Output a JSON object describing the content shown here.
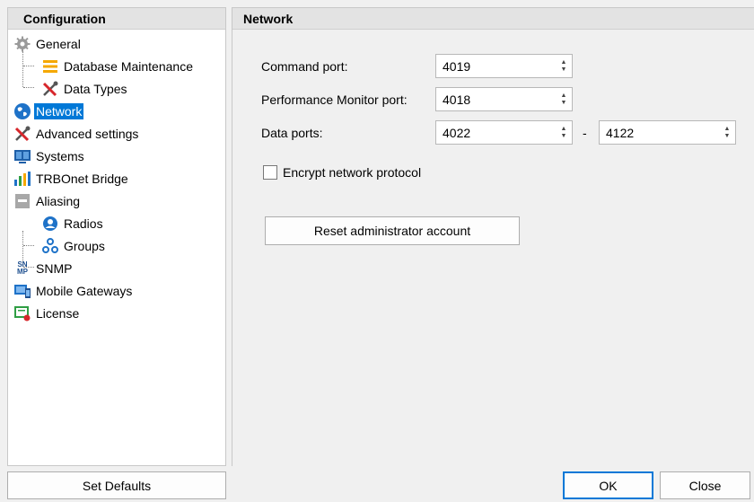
{
  "left": {
    "header": "Configuration",
    "items": [
      {
        "label": "General",
        "icon": "gear-icon"
      },
      {
        "label": "Database Maintenance",
        "icon": "database-maintenance-icon"
      },
      {
        "label": "Data Types",
        "icon": "tools-icon"
      },
      {
        "label": "Network",
        "icon": "globe-icon"
      },
      {
        "label": "Advanced settings",
        "icon": "tools-icon"
      },
      {
        "label": "Systems",
        "icon": "systems-icon"
      },
      {
        "label": "TRBOnet Bridge",
        "icon": "bridge-icon"
      },
      {
        "label": "Aliasing",
        "icon": "aliasing-icon"
      },
      {
        "label": "Radios",
        "icon": "radio-user-icon"
      },
      {
        "label": "Groups",
        "icon": "groups-icon"
      },
      {
        "label": "SNMP",
        "icon": "snmp-icon"
      },
      {
        "label": "Mobile Gateways",
        "icon": "mobile-gateways-icon"
      },
      {
        "label": "License",
        "icon": "license-icon"
      }
    ],
    "snmp_icon_text_top": "SN",
    "snmp_icon_text_bottom": "MP"
  },
  "right": {
    "header": "Network",
    "command_port_label": "Command port:",
    "command_port": "4019",
    "perf_port_label": "Performance Monitor port:",
    "perf_port": "4018",
    "data_ports_label": "Data ports:",
    "data_port_from": "4022",
    "data_port_dash": "-",
    "data_port_to": "4122",
    "encrypt_label": "Encrypt network protocol",
    "encrypt_checked": false,
    "reset_button": "Reset administrator account"
  },
  "footer": {
    "set_defaults": "Set Defaults",
    "ok": "OK",
    "close": "Close"
  },
  "colors": {
    "selection": "#0078d7"
  }
}
